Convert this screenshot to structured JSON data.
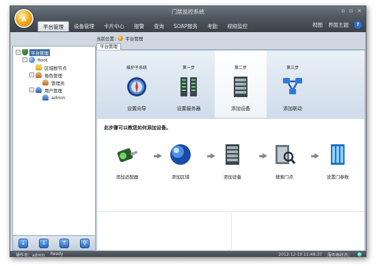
{
  "app": {
    "title": "门禁监控系统"
  },
  "window_controls": {
    "minimize": "▫",
    "restore": "▫",
    "close": "×"
  },
  "menu": {
    "items": [
      {
        "label": "平台管理",
        "active": true
      },
      {
        "label": "设备管理"
      },
      {
        "label": "卡片中心"
      },
      {
        "label": "报警"
      },
      {
        "label": "查询"
      },
      {
        "label": "SOAP服务"
      },
      {
        "label": "考勤"
      },
      {
        "label": "视频监控"
      }
    ],
    "right": {
      "view": "视图",
      "theme": "界面主题",
      "help": "?"
    }
  },
  "location": {
    "prefix": "当前位置:",
    "value": "平台管理"
  },
  "tab": {
    "label": "平台管理"
  },
  "tree": {
    "nodes": [
      {
        "label": "平台管理",
        "depth": 0,
        "expander": "-",
        "icon": "shield-icon",
        "selected": true
      },
      {
        "label": "Root",
        "depth": 1,
        "expander": "-",
        "icon": "globe-icon"
      },
      {
        "label": "区域根节点",
        "depth": 2,
        "expander": "",
        "icon": "folder-icon"
      },
      {
        "label": "角色管理",
        "depth": 2,
        "expander": "-",
        "icon": "users-icon"
      },
      {
        "label": "管理员",
        "depth": 3,
        "expander": "",
        "icon": "users-icon"
      },
      {
        "label": "用户管理",
        "depth": 2,
        "expander": "-",
        "icon": "user-icon"
      },
      {
        "label": "admin",
        "depth": 3,
        "expander": "",
        "icon": "user-icon"
      }
    ]
  },
  "left_toolbar": {
    "buttons": [
      "↓",
      "⇩",
      "↑",
      "⚲"
    ]
  },
  "steps": [
    {
      "title": "維护子系统",
      "label": "设置向导",
      "icon": "compass-icon",
      "active": false
    },
    {
      "title": "第一步",
      "label": "设置服务器",
      "icon": "server-icon",
      "active": false
    },
    {
      "title": "第二步",
      "label": "添加设备",
      "icon": "rack-icon",
      "active": true
    },
    {
      "title": "第三步",
      "label": "添加联动",
      "icon": "network-icon",
      "active": false
    }
  ],
  "hint": "此步骤可以教您如何添加设备。",
  "flow": [
    {
      "label": "添加适配器",
      "icon": "adapter-icon"
    },
    {
      "label": "添加区域",
      "icon": "globe-icon"
    },
    {
      "label": "添加设备",
      "icon": "rack-icon"
    },
    {
      "label": "搜索门点",
      "icon": "door-search-icon"
    },
    {
      "label": "设置门参数",
      "icon": "door-settings-icon"
    }
  ],
  "status": {
    "operator_label": "操作员：admin",
    "ready": "Ready",
    "datetime": "2012-12-10 11:48:37",
    "server_label": "服务器状态："
  },
  "colors": {
    "accent": "#3a6ea5",
    "header_dark": "#4e565f"
  }
}
